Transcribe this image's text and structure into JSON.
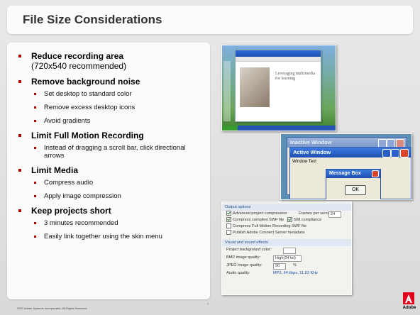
{
  "title": "File Size Considerations",
  "bullets": [
    {
      "label": "Reduce recording area",
      "sublabel": "(720x540 recommended)",
      "items": []
    },
    {
      "label": "Remove background noise",
      "items": [
        "Set desktop to standard color",
        "Remove excess desktop icons",
        "Avoid gradients"
      ]
    },
    {
      "label": "Limit Full Motion Recording",
      "items": [
        "Instead of dragging a scroll bar, click directional arrows"
      ]
    },
    {
      "label": "Limit Media",
      "items": [
        "Compress audio",
        "Apply image compression"
      ]
    },
    {
      "label": "Keep projects short",
      "items": [
        "3 minutes recommended",
        "Easily link together using the skin menu"
      ]
    }
  ],
  "screenshot_desktop": {
    "doc_text": "Leveraging multimedia for learning"
  },
  "screenshot_windows": {
    "inactive_window_title": "Inactive Window",
    "active_window_title": "Active Window",
    "window_text": "Window Text",
    "message_box_title": "Message Box",
    "ok_label": "OK"
  },
  "screenshot_options": {
    "output_header": "Output options",
    "advanced_compression": "Advanced project compression",
    "frames_per_second_label": "Frames per second:",
    "frames_per_second_value": "24",
    "compress_swf": "Compress compiled SWF file",
    "section_508": "508 compliance",
    "compress_fmr": "Compress Full Motion Recording SWF file",
    "publish_connect": "Publish Adobe Connect Server metadata",
    "visual_header": "Visual and sound effects",
    "bg_color_label": "Project background color:",
    "bmp_quality_label": "BMP image quality:",
    "bmp_quality_value": "High(24 bit)",
    "jpeg_quality_label": "JPEG image quality:",
    "jpeg_quality_value": "90",
    "jpeg_unit": "%",
    "audio_quality_label": "Audio quality:",
    "audio_quality_value": "MP3, 64 kbps, 11.03 KHz"
  },
  "footer": {
    "copyright": "2007 Adobe Systems Incorporated. All Rights Reserved.",
    "page_number": "7",
    "logo_text": "Adobe"
  },
  "colors": {
    "bullet": "#b30000",
    "logo": "#e0001b",
    "title_text": "#333333"
  }
}
